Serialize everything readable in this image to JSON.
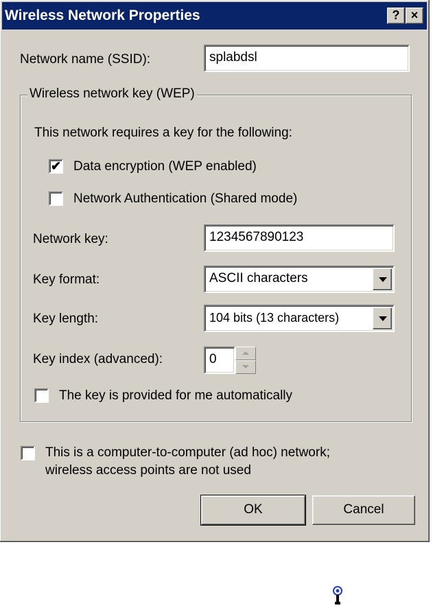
{
  "window": {
    "title": "Wireless Network Properties",
    "help_btn": "?",
    "close_btn": "×"
  },
  "ssid": {
    "label": "Network name (SSID):",
    "value": "splabdsl"
  },
  "wep_group": {
    "legend": "Wireless network key (WEP)",
    "intro": "This network requires a key for the following:",
    "data_encryption": {
      "label": "Data encryption (WEP enabled)",
      "checked": true
    },
    "network_auth": {
      "label": "Network Authentication (Shared mode)",
      "checked": false
    },
    "network_key": {
      "label": "Network key:",
      "value": "1234567890123"
    },
    "key_format": {
      "label": "Key format:",
      "value": "ASCII characters"
    },
    "key_length": {
      "label": "Key length:",
      "value": "104 bits (13 characters)"
    },
    "key_index": {
      "label": "Key index (advanced):",
      "value": "0"
    },
    "auto_key": {
      "label": "The key is provided for me automatically",
      "checked": false
    }
  },
  "adhoc": {
    "line1": "This is a computer-to-computer (ad hoc) network;",
    "line2": "wireless access points are not used",
    "checked": false
  },
  "buttons": {
    "ok": "OK",
    "cancel": "Cancel"
  },
  "icons": {
    "tray": "wireless-network-icon",
    "check": "✔"
  },
  "colors": {
    "titlebar": "#0a246a",
    "face": "#d4d0c8"
  }
}
